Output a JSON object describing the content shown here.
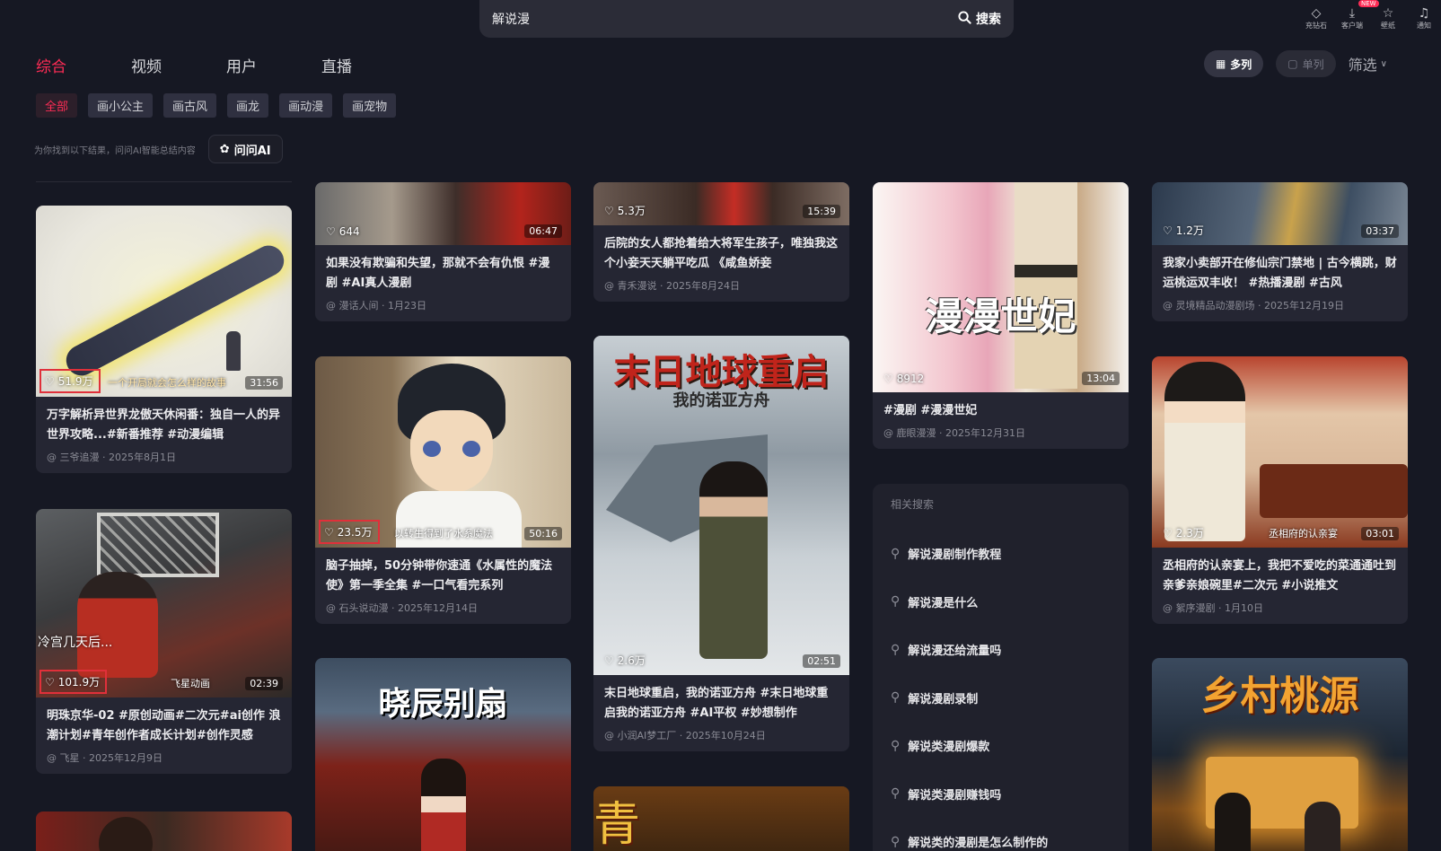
{
  "search": {
    "query": "解说漫",
    "button": "搜索"
  },
  "header_icons": [
    {
      "icon": "gem-icon",
      "label": "充钻石"
    },
    {
      "icon": "download-icon",
      "label": "客户端",
      "badge": "NEW"
    },
    {
      "icon": "star-icon",
      "label": "壁纸"
    },
    {
      "icon": "bell-icon",
      "label": "通知"
    }
  ],
  "tabs": [
    "综合",
    "视频",
    "用户",
    "直播"
  ],
  "view": {
    "multi_col": "多列",
    "single_col": "单列",
    "filter": "筛选"
  },
  "chips": [
    "全部",
    "画小公主",
    "画古风",
    "画龙",
    "画动漫",
    "画宠物"
  ],
  "ai_hint": {
    "text": "为你找到以下结果，问问AI智能总结内容",
    "button": "问问AI"
  },
  "cards": [
    {
      "likes": "51.9万",
      "overlay": "一个开局就会怎么样的故事",
      "duration": "31:56",
      "title": "万字解析异世界龙傲天休闲番：独自一人的异世界攻略...#新番推荐 #动漫编辑",
      "author": "@ 三爷追漫",
      "date": "2025年8月1日"
    },
    {
      "likes": "101.9万",
      "overlay": "飞星动画",
      "duration": "02:39",
      "title": "明珠京华-02 #原创动画#二次元#ai创作 浪潮计划#青年创作者成长计划#创作灵感",
      "author": "@ 飞星",
      "date": "2025年12月9日",
      "scene_text": "冷宫几天后..."
    },
    {
      "likes": "644",
      "duration": "06:47",
      "title": "如果没有欺骗和失望，那就不会有仇恨 #漫剧 #AI真人漫剧",
      "author": "@ 漫话人间",
      "date": "1月23日"
    },
    {
      "likes": "23.5万",
      "overlay": "以转生得到了水系魔法",
      "duration": "50:16",
      "title": "脑子抽掉，50分钟带你速通《水属性的魔法使》第一季全集 #一口气看完系列",
      "author": "@ 石头说动漫",
      "date": "2025年12月14日"
    },
    {
      "cover_text": "晓辰别扇"
    },
    {
      "likes": "5.3万",
      "duration": "15:39",
      "title": "后院的女人都抢着给大将军生孩子，唯独我这个小妾天天躺平吃瓜 《咸鱼娇妾",
      "author": "@ 青禾漫说",
      "date": "2025年8月24日"
    },
    {
      "likes": "2.6万",
      "duration": "02:51",
      "cover_text": "末日地球重启",
      "cover_sub": "我的诺亚方舟",
      "title": "末日地球重启，我的诺亚方舟 #末日地球重启我的诺亚方舟 #AI平权 #妙想制作",
      "author": "@ 小润AI梦工厂",
      "date": "2025年10月24日"
    },
    {
      "cover_text": "青"
    },
    {
      "likes": "8912",
      "duration": "13:04",
      "cover_text": "漫漫世妃",
      "title": "#漫剧 #漫漫世妃",
      "author": "@ 鹿眼漫漫",
      "date": "2025年12月31日"
    },
    {
      "likes": "1.2万",
      "duration": "03:37",
      "title": "我家小卖部开在修仙宗门禁地 | 古今横跳，财运桃运双丰收！ #热播漫剧 #古风",
      "author": "@ 灵境精品动漫剧场",
      "date": "2025年12月19日"
    },
    {
      "likes": "2.3万",
      "overlay": "丞相府的认亲宴",
      "duration": "03:01",
      "title": "丞相府的认亲宴上，我把不爱吃的菜通通吐到亲爹亲娘碗里#二次元 #小说推文",
      "author": "@ 絮序漫剧",
      "date": "1月10日"
    },
    {
      "cover_text": "乡村桃源"
    }
  ],
  "related": {
    "heading": "相关搜索",
    "items": [
      "解说漫剧制作教程",
      "解说漫是什么",
      "解说漫还给流量吗",
      "解说漫剧录制",
      "解说类漫剧爆款",
      "解说类漫剧赚钱吗",
      "解说类的漫剧是怎么制作的"
    ]
  },
  "colors": {
    "accent": "#fe2c55",
    "background": "#161823",
    "card": "#252633"
  }
}
